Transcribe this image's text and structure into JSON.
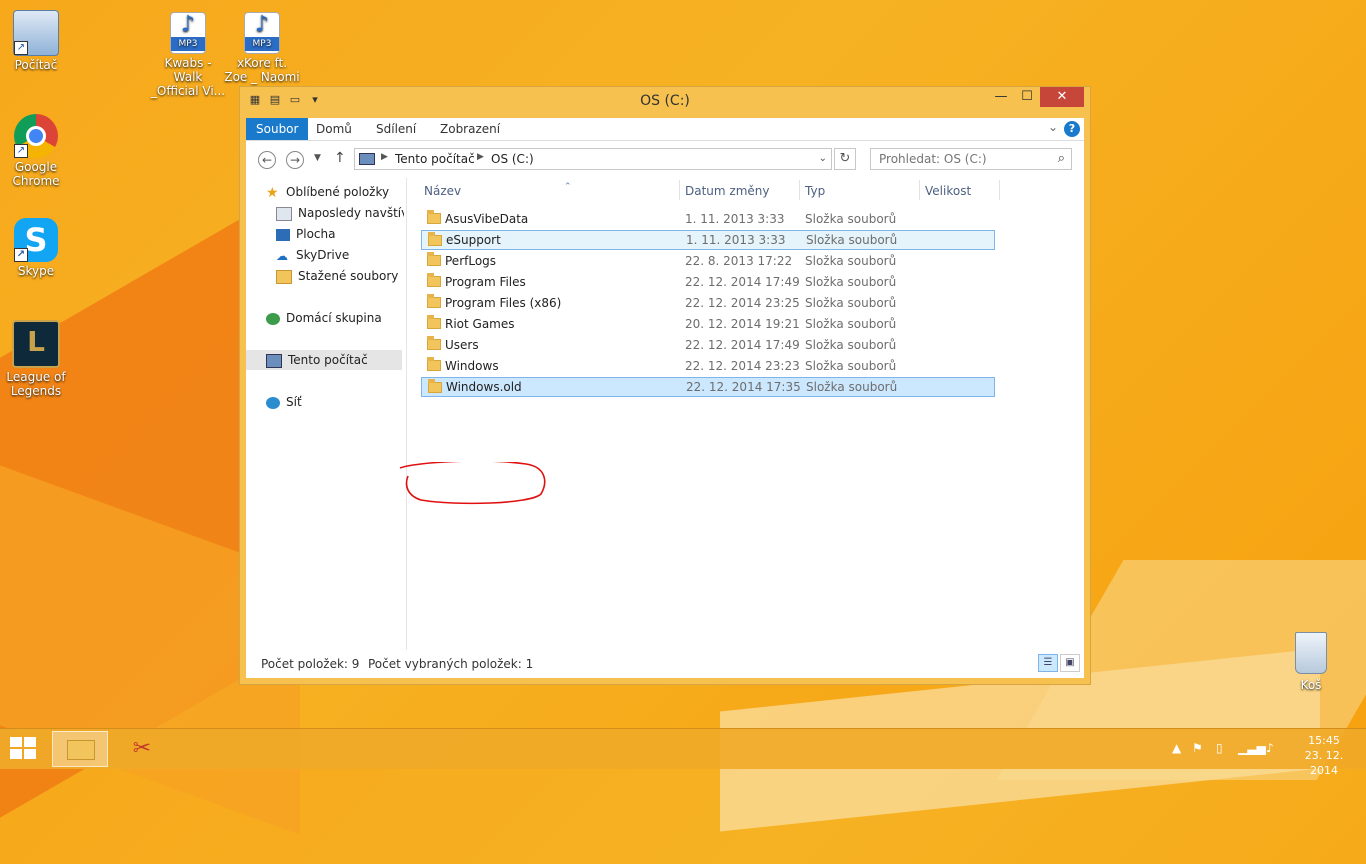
{
  "desktop": {
    "icons": [
      {
        "label": "Počítač"
      },
      {
        "label": "Google Chrome"
      },
      {
        "label": "Skype"
      },
      {
        "label": "League of Legends"
      },
      {
        "label": "Kwabs - Walk _Official Vi..."
      },
      {
        "label": "xKore ft. Zoe _ Naomi - ..."
      }
    ],
    "mp3_tag": "MP3",
    "recycle_bin": "Koš"
  },
  "window": {
    "title": "OS (C:)",
    "ribbon_tabs": [
      "Soubor",
      "Domů",
      "Sdílení",
      "Zobrazení"
    ],
    "help": "?",
    "breadcrumb": [
      "Tento počítač",
      "OS (C:)"
    ],
    "search_placeholder": "Prohledat: OS (C:)",
    "nav_pane": {
      "favorites": "Oblíbené položky",
      "favorites_items": [
        "Naposledy navštívené",
        "Plocha",
        "SkyDrive",
        "Stažené soubory"
      ],
      "homegroup": "Domácí skupina",
      "this_pc": "Tento počítač",
      "network": "Síť"
    },
    "columns": [
      "Název",
      "Datum změny",
      "Typ",
      "Velikost"
    ],
    "files": [
      {
        "name": "AsusVibeData",
        "date": "1. 11. 2013 3:33",
        "type": "Složka souborů"
      },
      {
        "name": "eSupport",
        "date": "1. 11. 2013 3:33",
        "type": "Složka souborů"
      },
      {
        "name": "PerfLogs",
        "date": "22. 8. 2013 17:22",
        "type": "Složka souborů"
      },
      {
        "name": "Program Files",
        "date": "22. 12. 2014 17:49",
        "type": "Složka souborů"
      },
      {
        "name": "Program Files (x86)",
        "date": "22. 12. 2014 23:25",
        "type": "Složka souborů"
      },
      {
        "name": "Riot Games",
        "date": "20. 12. 2014 19:21",
        "type": "Složka souborů"
      },
      {
        "name": "Users",
        "date": "22. 12. 2014 17:49",
        "type": "Složka souborů"
      },
      {
        "name": "Windows",
        "date": "22. 12. 2014 23:23",
        "type": "Složka souborů"
      },
      {
        "name": "Windows.old",
        "date": "22. 12. 2014 17:35",
        "type": "Složka souborů"
      }
    ],
    "status": {
      "count": "Počet položek: 9",
      "selected": "Počet vybraných položek: 1"
    }
  },
  "taskbar": {
    "time": "15:45",
    "date": "23. 12. 2014"
  },
  "colors": {
    "accent": "#1979ca",
    "selection": "#cce8ff",
    "annotation": "#e01010",
    "window_frame": "#f6c14f"
  }
}
